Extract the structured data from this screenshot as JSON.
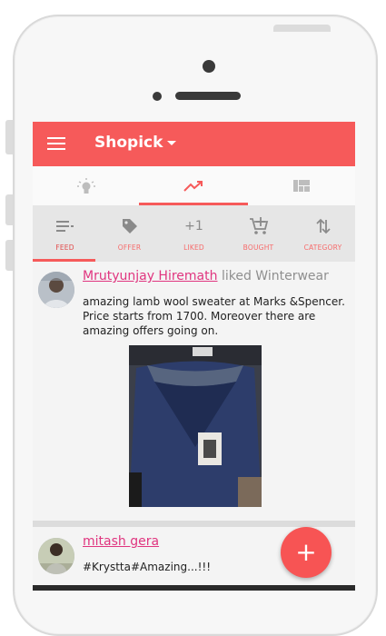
{
  "app": {
    "title": "Shopick",
    "accent_color": "#f65a5a"
  },
  "tabs": [
    {
      "name": "ideas",
      "icon": "lightbulb-icon",
      "active": false
    },
    {
      "name": "trending",
      "icon": "trending-up-icon",
      "active": true
    },
    {
      "name": "grid",
      "icon": "grid-icon",
      "active": false
    }
  ],
  "subtabs": [
    {
      "label": "FEED",
      "icon": "feed-list-icon",
      "active": true
    },
    {
      "label": "OFFER",
      "icon": "tag-icon",
      "active": false
    },
    {
      "label": "LIKED",
      "icon": "plus-one-icon",
      "icon_text": "+1",
      "active": false
    },
    {
      "label": "BOUGHT",
      "icon": "cart-add-icon",
      "active": false
    },
    {
      "label": "CATEGORY",
      "icon": "sort-arrows-icon",
      "active": false
    }
  ],
  "feed": [
    {
      "user": "Mrutyunjay Hiremath",
      "action": "liked Winterwear",
      "text": "amazing lamb wool sweater at Marks &Spencer. Price starts from 1700. Moreover there are amazing offers going on.",
      "image": "sweater-photo"
    },
    {
      "user": "mitash gera",
      "action": "",
      "text": "#Krystta#Amazing...!!!"
    }
  ],
  "fab": {
    "label": "+",
    "icon": "add-icon"
  }
}
